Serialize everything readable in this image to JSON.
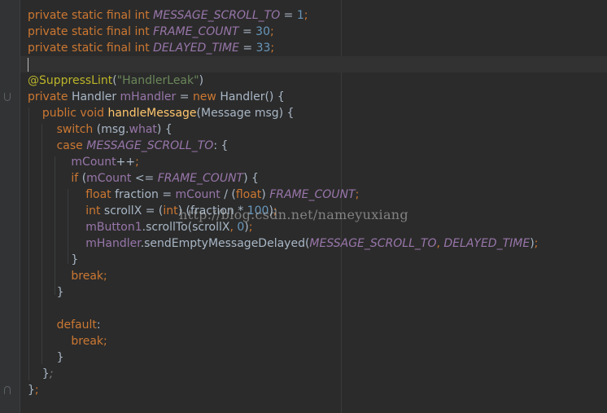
{
  "editor": {
    "lines": [
      [
        [
          "kw",
          "private static final int "
        ],
        [
          "const",
          "MESSAGE_SCROLL_TO"
        ],
        [
          "plain",
          " = "
        ],
        [
          "num",
          "1"
        ],
        [
          "punct",
          ";"
        ]
      ],
      [
        [
          "kw",
          "private static final int "
        ],
        [
          "const",
          "FRAME_COUNT"
        ],
        [
          "plain",
          " = "
        ],
        [
          "num",
          "30"
        ],
        [
          "punct",
          ";"
        ]
      ],
      [
        [
          "kw",
          "private static final int "
        ],
        [
          "const",
          "DELAYED_TIME"
        ],
        [
          "plain",
          " = "
        ],
        [
          "num",
          "33"
        ],
        [
          "punct",
          ";"
        ]
      ],
      [],
      [
        [
          "ann",
          "@SuppressLint"
        ],
        [
          "plain",
          "("
        ],
        [
          "str",
          "\"HandlerLeak\""
        ],
        [
          "plain",
          ")"
        ]
      ],
      [
        [
          "kw",
          "private "
        ],
        [
          "plain",
          "Handler "
        ],
        [
          "field",
          "mHandler"
        ],
        [
          "plain",
          " = "
        ],
        [
          "kw",
          "new "
        ],
        [
          "plain",
          "Handler() {"
        ]
      ],
      [
        [
          "plain",
          "    "
        ],
        [
          "kw",
          "public void "
        ],
        [
          "method",
          "handleMessage"
        ],
        [
          "plain",
          "(Message msg) {"
        ]
      ],
      [
        [
          "plain",
          "        "
        ],
        [
          "kw",
          "switch "
        ],
        [
          "plain",
          "(msg."
        ],
        [
          "field",
          "what"
        ],
        [
          "plain",
          ") {"
        ]
      ],
      [
        [
          "plain",
          "        "
        ],
        [
          "kw",
          "case "
        ],
        [
          "const",
          "MESSAGE_SCROLL_TO"
        ],
        [
          "plain",
          ": {"
        ]
      ],
      [
        [
          "plain",
          "            "
        ],
        [
          "field",
          "mCount"
        ],
        [
          "plain",
          "++"
        ],
        [
          "punct",
          ";"
        ]
      ],
      [
        [
          "plain",
          "            "
        ],
        [
          "kw",
          "if "
        ],
        [
          "plain",
          "("
        ],
        [
          "field",
          "mCount"
        ],
        [
          "plain",
          " <= "
        ],
        [
          "const",
          "FRAME_COUNT"
        ],
        [
          "plain",
          ") {"
        ]
      ],
      [
        [
          "plain",
          "                "
        ],
        [
          "kw",
          "float "
        ],
        [
          "plain",
          "fraction = "
        ],
        [
          "field",
          "mCount"
        ],
        [
          "plain",
          " / ("
        ],
        [
          "kw",
          "float"
        ],
        [
          "plain",
          ") "
        ],
        [
          "const",
          "FRAME_COUNT"
        ],
        [
          "punct",
          ";"
        ]
      ],
      [
        [
          "plain",
          "                "
        ],
        [
          "kw",
          "int "
        ],
        [
          "plain",
          "scrollX = ("
        ],
        [
          "kw",
          "int"
        ],
        [
          "plain",
          ") (fraction * "
        ],
        [
          "num",
          "100"
        ],
        [
          "plain",
          ")"
        ],
        [
          "punct",
          ";"
        ]
      ],
      [
        [
          "plain",
          "                "
        ],
        [
          "field",
          "mButton1"
        ],
        [
          "plain",
          ".scrollTo(scrollX"
        ],
        [
          "punct",
          ", "
        ],
        [
          "num",
          "0"
        ],
        [
          "plain",
          ")"
        ],
        [
          "punct",
          ";"
        ]
      ],
      [
        [
          "plain",
          "                "
        ],
        [
          "field",
          "mHandler"
        ],
        [
          "plain",
          ".sendEmptyMessageDelayed("
        ],
        [
          "const",
          "MESSAGE_SCROLL_TO"
        ],
        [
          "punct",
          ", "
        ],
        [
          "const",
          "DELAYED_TIME"
        ],
        [
          "plain",
          ")"
        ],
        [
          "punct",
          ";"
        ]
      ],
      [
        [
          "plain",
          "            }"
        ]
      ],
      [
        [
          "plain",
          "            "
        ],
        [
          "kw",
          "break"
        ],
        [
          "punct",
          ";"
        ]
      ],
      [
        [
          "plain",
          "        }"
        ]
      ],
      [],
      [
        [
          "plain",
          "        "
        ],
        [
          "kw",
          "default"
        ],
        [
          "plain",
          ":"
        ]
      ],
      [
        [
          "plain",
          "            "
        ],
        [
          "kw",
          "break"
        ],
        [
          "punct",
          ";"
        ]
      ],
      [
        [
          "plain",
          "        }"
        ]
      ],
      [
        [
          "plain",
          "    }"
        ],
        [
          "dim",
          ";"
        ]
      ],
      [
        [
          "plain",
          "}"
        ],
        [
          "punct",
          ";"
        ]
      ]
    ]
  },
  "watermark": "http://blog.csdn.net/nameyuxiang"
}
